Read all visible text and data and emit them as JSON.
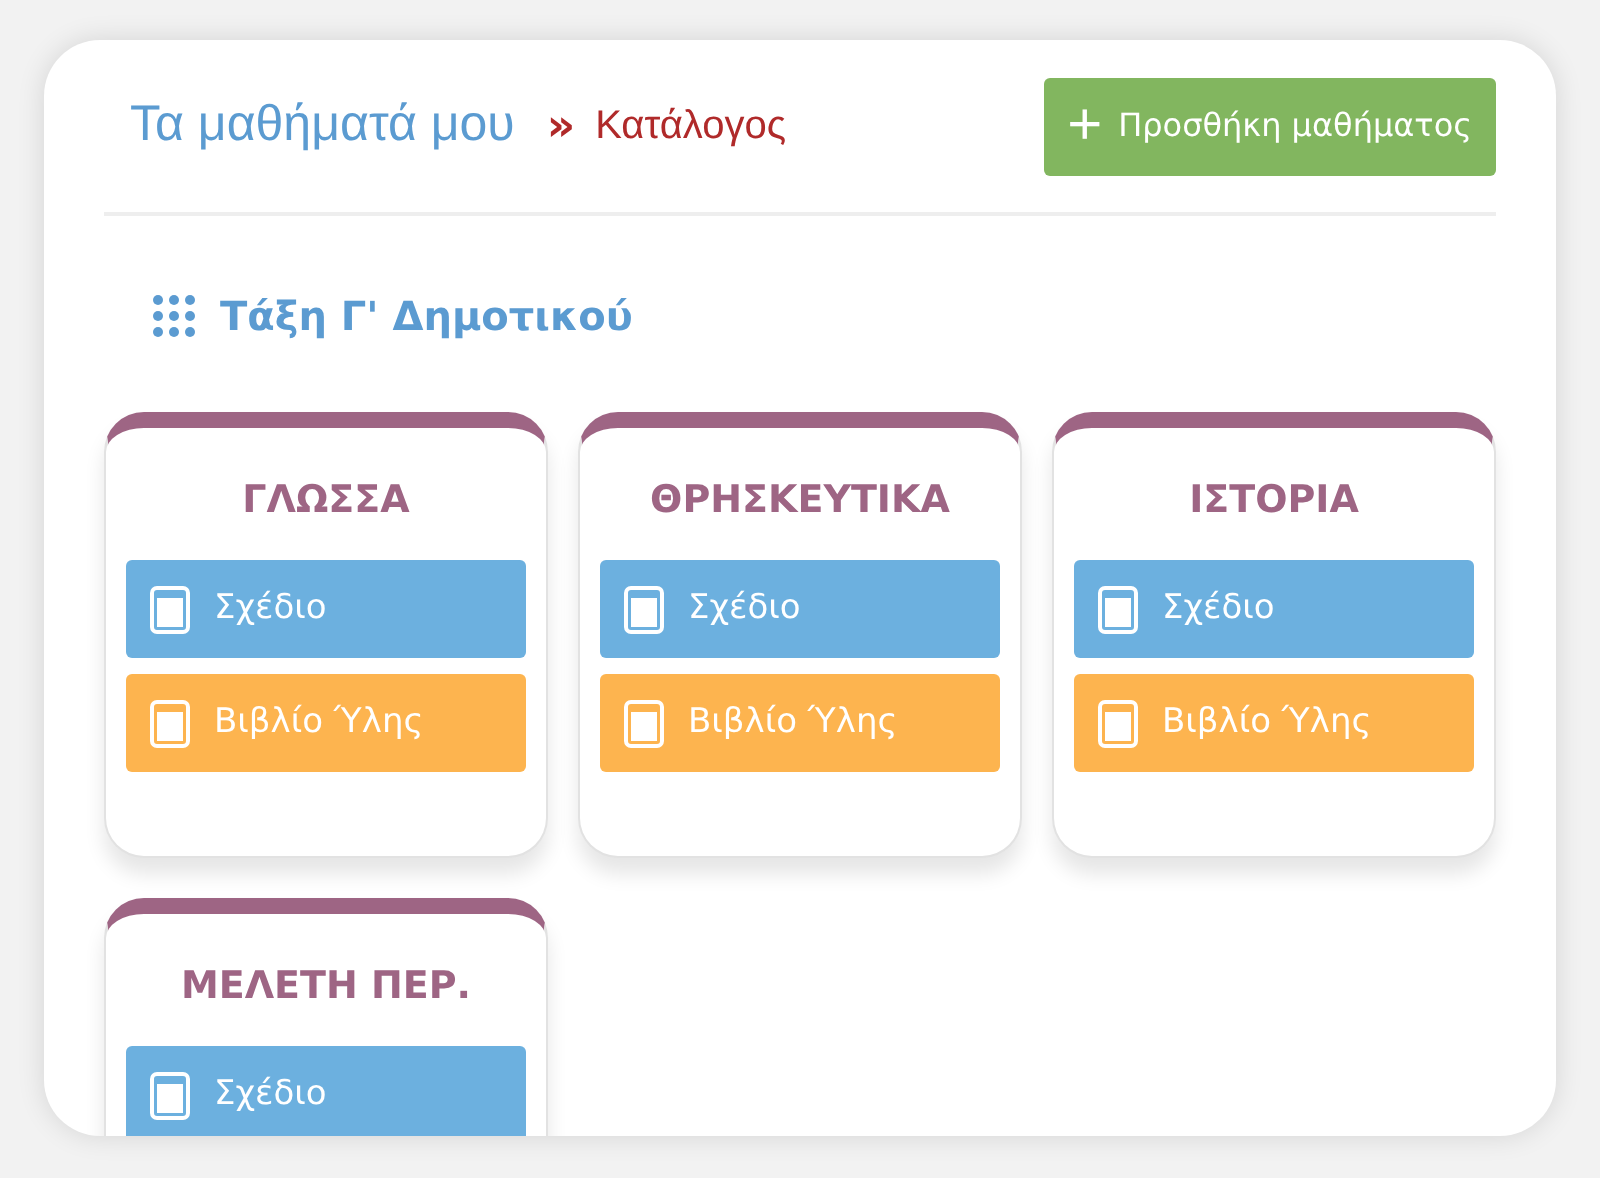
{
  "header": {
    "title": "Τα μαθήματά μου",
    "separator": "»",
    "breadcrumb": "Κατάλογος",
    "add_button": {
      "icon": "+",
      "label": "Προσθήκη μαθήματος"
    }
  },
  "section": {
    "title": "Τάξη Γ' Δημοτικού"
  },
  "courses": [
    {
      "title": "ΓΛΩΣΣΑ",
      "items": [
        {
          "kind": "plan",
          "label": "Σχέδιο"
        },
        {
          "kind": "book",
          "label": "Βιβλίο Ύλης"
        }
      ]
    },
    {
      "title": "ΘΡΗΣΚΕΥΤΙΚΑ",
      "items": [
        {
          "kind": "plan",
          "label": "Σχέδιο"
        },
        {
          "kind": "book",
          "label": "Βιβλίο Ύλης"
        }
      ]
    },
    {
      "title": "ΙΣΤΟΡΙΑ",
      "items": [
        {
          "kind": "plan",
          "label": "Σχέδιο"
        },
        {
          "kind": "book",
          "label": "Βιβλίο Ύλης"
        }
      ]
    },
    {
      "title": "ΜΕΛΕΤΗ ΠΕΡ.",
      "items": [
        {
          "kind": "plan",
          "label": "Σχέδιο"
        }
      ]
    }
  ]
}
